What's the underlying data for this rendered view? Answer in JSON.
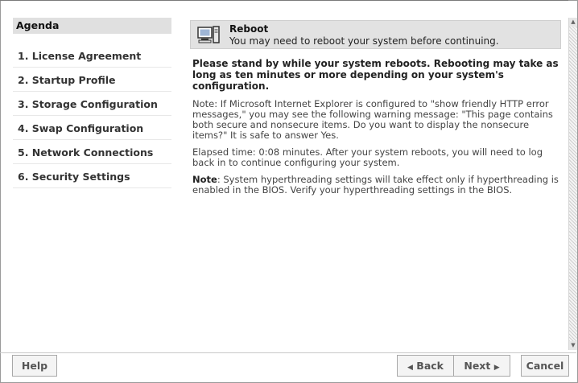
{
  "agenda": {
    "title": "Agenda",
    "items": [
      {
        "label": "1. License Agreement"
      },
      {
        "label": "2. Startup Profile"
      },
      {
        "label": "3. Storage Configuration"
      },
      {
        "label": "4. Swap Configuration"
      },
      {
        "label": "5. Network Connections"
      },
      {
        "label": "6. Security Settings"
      }
    ]
  },
  "header": {
    "icon": "computer-icon",
    "title": "Reboot",
    "subtitle": "You may need to reboot your system before continuing."
  },
  "content": {
    "lead": "Please stand by while your system reboots. Rebooting may take as long as ten minutes or more depending on your system's configuration.",
    "note_ie": "Note: If Microsoft Internet Explorer is configured to \"show friendly HTTP error messages,\" you may see the following warning message: \"This page contains both secure and nonsecure items. Do you want to display the nonsecure items?\" It is safe to answer Yes.",
    "elapsed": "Elapsed time: 0:08 minutes. After your system reboots, you will need to log back in to continue configuring your system.",
    "note_label": "Note",
    "note_hyper": ": System hyperthreading settings will take effect only if hyperthreading is enabled in the BIOS. Verify your hyperthreading settings in the BIOS."
  },
  "footer": {
    "help": "Help",
    "back": "Back",
    "back_icon": "◀",
    "next": "Next",
    "next_icon": "▶",
    "cancel": "Cancel"
  }
}
